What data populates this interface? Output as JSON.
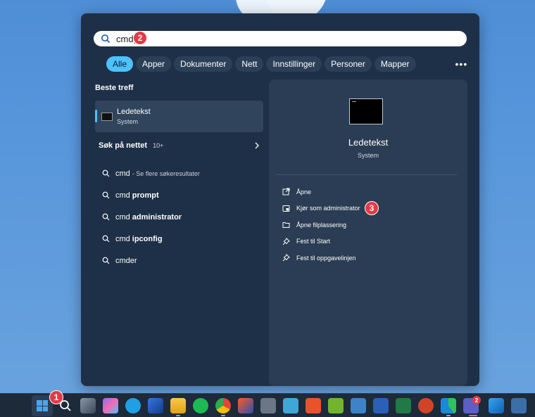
{
  "search": {
    "value": "cmd"
  },
  "badges": {
    "search": "2",
    "start": "1",
    "admin": "3"
  },
  "filters": [
    "Alle",
    "Apper",
    "Dokumenter",
    "Nett",
    "Innstillinger",
    "Personer",
    "Mapper"
  ],
  "best_match": {
    "heading": "Beste treff",
    "name": "Ledetekst",
    "type": "System"
  },
  "web": {
    "heading": "Søk på nettet",
    "count": "10+",
    "items": [
      {
        "query": "cmd",
        "bold": "",
        "muted": "- Se flere søkeresultater"
      },
      {
        "query": "cmd",
        "bold": "prompt",
        "muted": ""
      },
      {
        "query": "cmd",
        "bold": "administrator",
        "muted": ""
      },
      {
        "query": "cmd",
        "bold": "ipconfig",
        "muted": ""
      },
      {
        "query": "",
        "bold": "cmder",
        "muted": ""
      }
    ]
  },
  "detail": {
    "title": "Ledetekst",
    "subtitle": "System",
    "actions": [
      "Åpne",
      "Kjør som administrator",
      "Åpne filplassering",
      "Fest til Start",
      "Fest til oppgavelinjen"
    ]
  },
  "taskbar": {
    "teams_badge": "2"
  },
  "colors": {
    "accent": "#4cc2ff",
    "badge": "#e63946",
    "panel": "#1e3047"
  }
}
